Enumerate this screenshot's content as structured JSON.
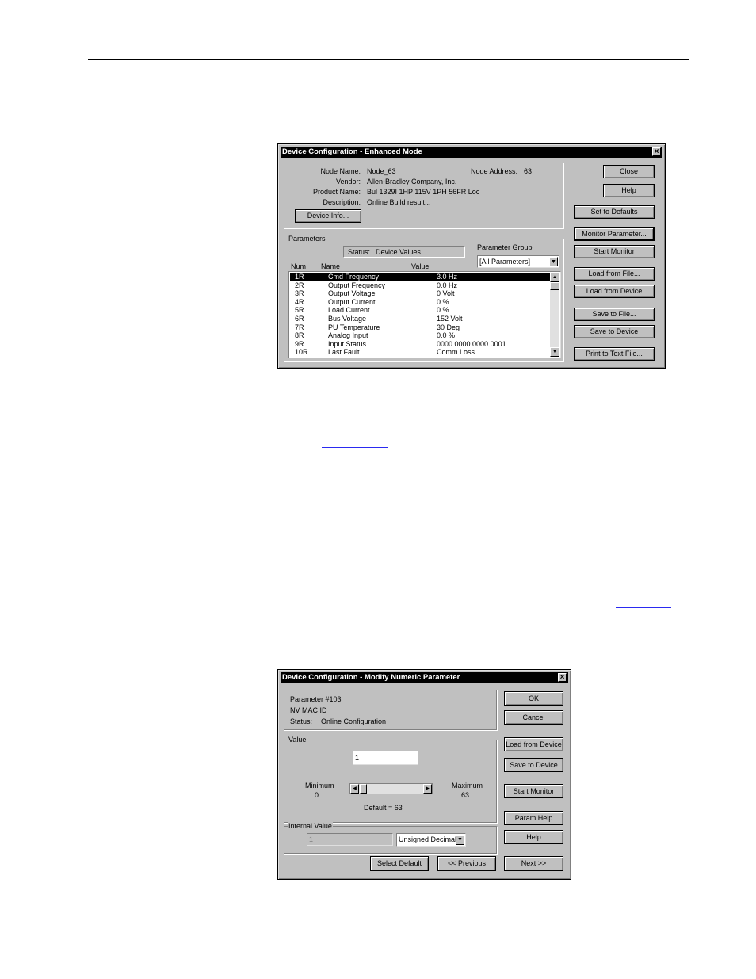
{
  "dialog1": {
    "title": "Device Configuration - Enhanced Mode",
    "node_name_label": "Node Name:",
    "node_name": "Node_63",
    "node_address_label": "Node Address:",
    "node_address": "63",
    "vendor_label": "Vendor:",
    "vendor": "Allen-Bradley Company, Inc.",
    "product_name_label": "Product Name:",
    "product_name": "Bul 1329I 1HP 115V 1PH  56FR Loc",
    "description_label": "Description:",
    "description": "Online Build result...",
    "device_info_button": "Device Info...",
    "parameters_group": "Parameters",
    "status_label": "Status:",
    "status_value": "Device Values",
    "parameter_group_label": "Parameter Group",
    "parameter_group_value": "[All Parameters]",
    "columns": {
      "num": "Num",
      "name": "Name",
      "value": "Value"
    },
    "rows": [
      {
        "num": "1R",
        "name": "Cmd Frequency",
        "value": "3.0 Hz"
      },
      {
        "num": "2R",
        "name": "Output Frequency",
        "value": "0.0 Hz"
      },
      {
        "num": "3R",
        "name": "Output Voltage",
        "value": "0 Volt"
      },
      {
        "num": "4R",
        "name": "Output Current",
        "value": "0 %"
      },
      {
        "num": "5R",
        "name": "Load Current",
        "value": "0 %"
      },
      {
        "num": "6R",
        "name": "Bus Voltage",
        "value": "152 Volt"
      },
      {
        "num": "7R",
        "name": "PU Temperature",
        "value": "30 Deg"
      },
      {
        "num": "8R",
        "name": "Analog Input",
        "value": "0.0 %"
      },
      {
        "num": "9R",
        "name": "Input Status",
        "value": "0000 0000 0000 0001"
      },
      {
        "num": "10R",
        "name": "Last Fault",
        "value": "Comm Loss"
      }
    ],
    "buttons": {
      "close": "Close",
      "help": "Help",
      "set_defaults": "Set to Defaults",
      "monitor_parameter": "Monitor Parameter...",
      "start_monitor": "Start Monitor",
      "load_from_file": "Load from File...",
      "load_from_device": "Load from Device",
      "save_to_file": "Save to File...",
      "save_to_device": "Save to Device",
      "print_to_text_file": "Print to Text File..."
    }
  },
  "dialog2": {
    "title": "Device Configuration - Modify Numeric Parameter",
    "parameter_number": "Parameter #103",
    "parameter_name": "NV MAC ID",
    "status_label": "Status:",
    "status_value": "Online Configuration",
    "value_group": "Value",
    "value_input": "1",
    "minimum_label": "Minimum",
    "minimum_value": "0",
    "maximum_label": "Maximum",
    "maximum_value": "63",
    "default_text": "Default = 63",
    "slider_fraction": 0.016,
    "internal_value_group": "Internal Value",
    "internal_value": "1",
    "format_value": "Unsigned Decimal",
    "buttons": {
      "ok": "OK",
      "cancel": "Cancel",
      "load_from_device": "Load from Device",
      "save_to_device": "Save to Device",
      "start_monitor": "Start Monitor",
      "param_help": "Param Help",
      "help": "Help",
      "select_default": "Select Default",
      "previous": "<< Previous",
      "next": "Next >>"
    }
  }
}
